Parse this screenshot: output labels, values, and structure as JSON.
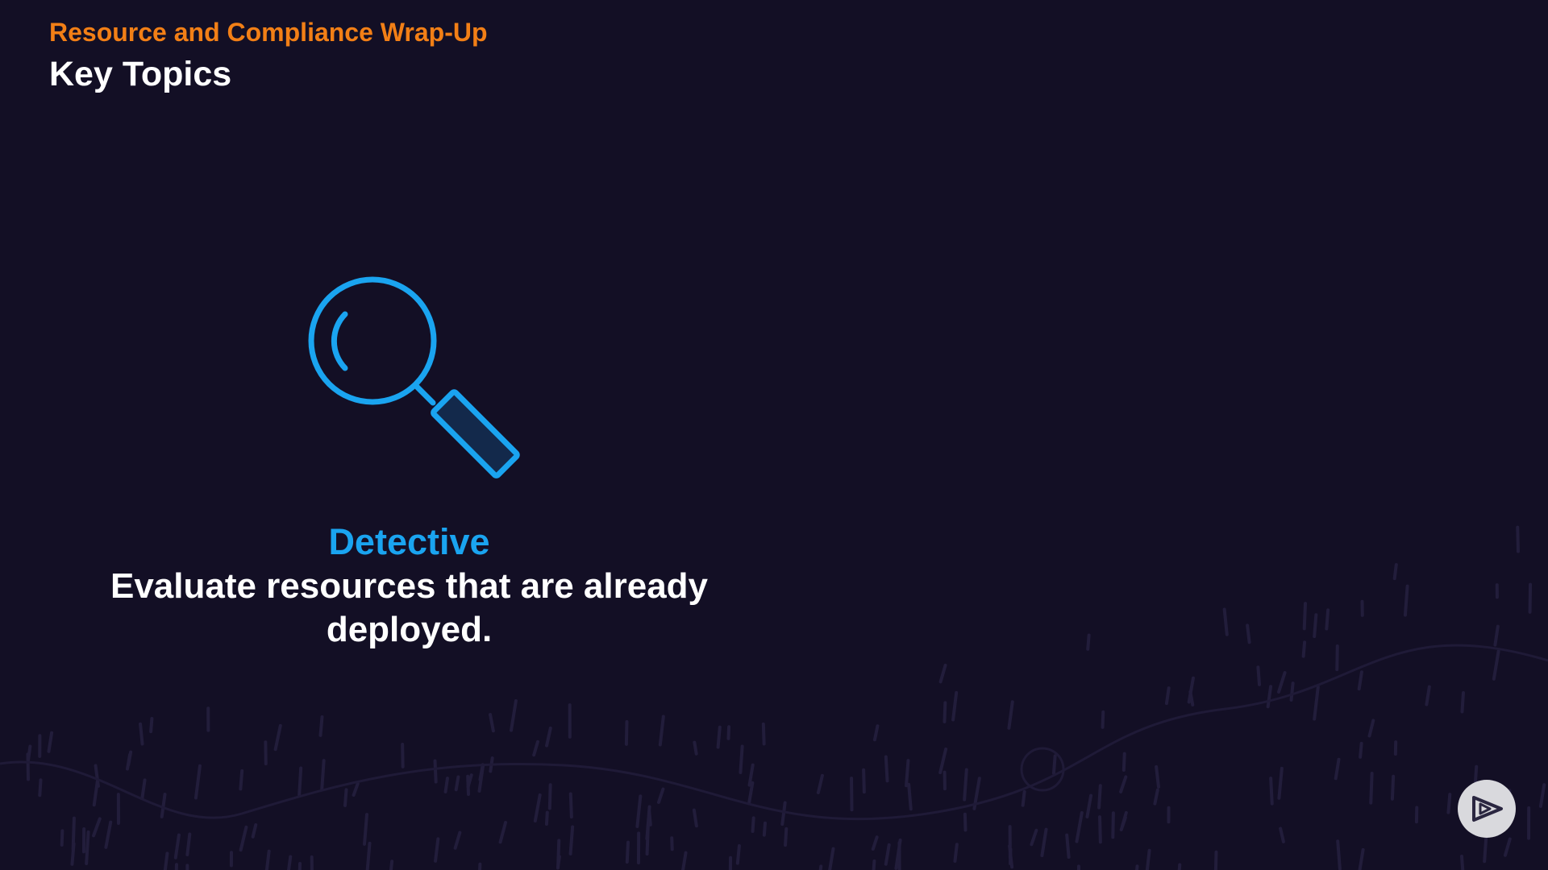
{
  "header": {
    "subtitle": "Resource and Compliance Wrap-Up",
    "title": "Key Topics"
  },
  "topic": {
    "heading": "Detective",
    "description": "Evaluate resources that are already deployed.",
    "icon": "magnifying-glass-icon"
  },
  "controls": {
    "play_icon": "play-logo-icon"
  },
  "colors": {
    "background": "#130f25",
    "accent_orange": "#f27f16",
    "accent_blue": "#1aa4f0",
    "text": "#ffffff"
  }
}
